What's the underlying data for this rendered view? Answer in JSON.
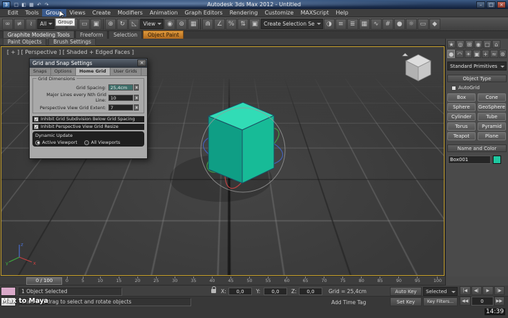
{
  "colors": {
    "viewport_border": "#c9a22b",
    "cube_top": "#31dcb6",
    "cube_left": "#0f9e85",
    "cube_right": "#17bb97",
    "gizmo_red": "#cc4444",
    "gizmo_green": "#44aa44",
    "gizmo_blue": "#4466cc",
    "object_swatch": "#1ec8a0"
  },
  "window": {
    "title": "Autodesk 3ds Max 2012 - Untitled",
    "logo": "3",
    "quick_icons": [
      "□",
      "◧",
      "▦",
      "↶",
      "↷"
    ],
    "min": "–",
    "max": "□",
    "close": "×",
    "clock": "14:39",
    "watermark": "Max to Maya"
  },
  "menubar": {
    "items": [
      "Edit",
      "Tools",
      "Group",
      "Views",
      "Create",
      "Modifiers",
      "Animation",
      "Graph Editors",
      "Rendering",
      "Customize",
      "MAXScript",
      "Help"
    ],
    "tooltip": "Group"
  },
  "toolbar": {
    "filter_value": "All",
    "coord_value": "View",
    "selset_value": "Create Selection Se",
    "icons": [
      "∞",
      "≠",
      "≀",
      "↖",
      "▤",
      "▭",
      "▣",
      "⊕",
      "↻",
      "◺",
      "◉",
      "⊚",
      "▦",
      "⋒",
      "∠",
      "%",
      "⇅",
      "▣",
      "◑",
      "≡",
      "≣",
      "▦",
      "∿",
      "#",
      "●",
      "☼",
      "▭",
      "◆"
    ]
  },
  "ribbon": {
    "tabs": [
      "Graphite Modeling Tools",
      "Freeform",
      "Selection"
    ],
    "paint_tab": "Object Paint",
    "subtabs": [
      "Paint Objects",
      "Brush Settings"
    ]
  },
  "viewport": {
    "label": "[ + ] [ Perspective ] [ Shaded + Edged Faces ]",
    "axis_x": "x",
    "axis_y": "y",
    "axis_z": "z"
  },
  "dialog": {
    "title": "Grid and Snap Settings",
    "close": "×",
    "tabs": [
      "Snaps",
      "Options",
      "Home Grid",
      "User Grids"
    ],
    "group_title": "Grid Dimensions",
    "fields": [
      {
        "label": "Grid Spacing:",
        "value": "25,4cm"
      },
      {
        "label": "Major Lines every Nth Grid Line:",
        "value": "10"
      },
      {
        "label": "Perspective View Grid Extent:",
        "value": "7"
      }
    ],
    "checkboxes": [
      {
        "label": "Inhibit Grid Subdivision Below Grid Spacing",
        "glyph": "✓"
      },
      {
        "label": "Inhibit Perspective View Grid Resize",
        "glyph": "✓"
      }
    ],
    "dynamic_title": "Dynamic Update",
    "radios": [
      {
        "label": "Active Viewport"
      },
      {
        "label": "All Viewports"
      }
    ]
  },
  "panel": {
    "tab_icons": [
      "★",
      "◎",
      "⊞",
      "◉",
      "▢",
      "⌂"
    ],
    "cat_icons": [
      "●",
      "◠",
      "☀",
      "▣",
      "+",
      "≈",
      "⊛"
    ],
    "dropdown": "Standard Primitives",
    "rollout_object_type": "Object Type",
    "autogrid": "AutoGrid",
    "buttons": [
      "Box",
      "Cone",
      "Sphere",
      "GeoSphere",
      "Cylinder",
      "Tube",
      "Torus",
      "Pyramid",
      "Teapot",
      "Plane"
    ],
    "rollout_name_color": "Name and Color",
    "object_name": "Box001"
  },
  "timeline": {
    "handle": "0 / 100",
    "labels": [
      "0",
      "5",
      "10",
      "15",
      "20",
      "25",
      "30",
      "35",
      "40",
      "45",
      "50",
      "55",
      "60",
      "65",
      "70",
      "75",
      "80",
      "85",
      "90",
      "95",
      "100"
    ]
  },
  "status": {
    "selection": "1 Object Selected",
    "prompt": "Click and drag to select and rotate objects",
    "x": "X:",
    "xv": "0,0",
    "y": "Y:",
    "yv": "0,0",
    "z": "Z:",
    "zv": "0,0",
    "grid": "Grid = 25,4cm",
    "add_time_tag": "Add Time Tag",
    "auto_key": "Auto Key",
    "selected_dd": "Selected",
    "set_key": "Set Key",
    "key_filters": "Key Filters...",
    "t_start": "|◀",
    "t_prev": "◀|",
    "t_play": "▶",
    "t_next": "|▶",
    "t_rew": "◀◀",
    "t_fwd": "▶▶",
    "frame": "0"
  }
}
